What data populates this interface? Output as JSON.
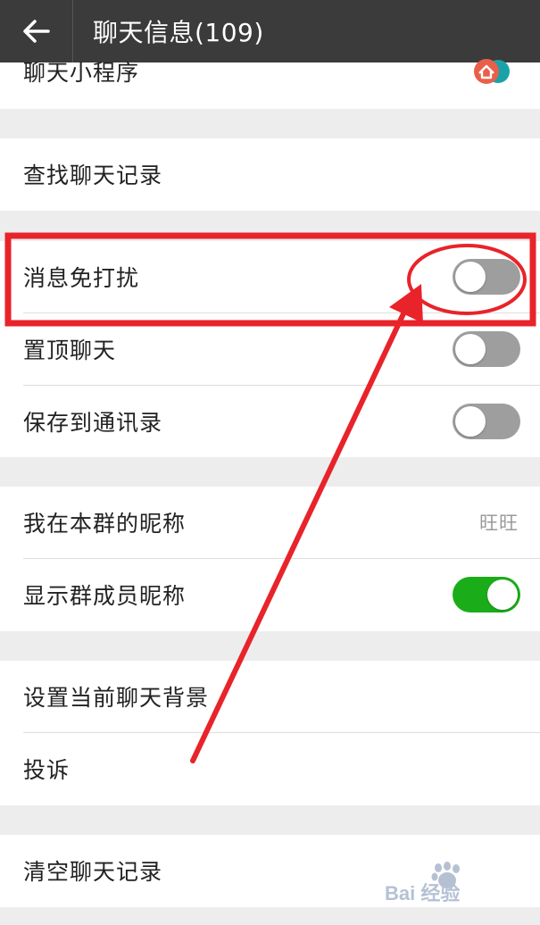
{
  "header": {
    "title": "聊天信息(109)"
  },
  "sections": {
    "miniprogram": {
      "label": "聊天小程序",
      "icon": "mini-program-icon"
    },
    "search": {
      "label": "查找聊天记录"
    },
    "dnd": {
      "label": "消息免打扰",
      "on": false
    },
    "pin": {
      "label": "置顶聊天",
      "on": false
    },
    "save_contacts": {
      "label": "保存到通讯录",
      "on": false
    },
    "nickname": {
      "label": "我在本群的昵称",
      "value": "旺旺"
    },
    "show_nicknames": {
      "label": "显示群成员昵称",
      "on": true
    },
    "background": {
      "label": "设置当前聊天背景"
    },
    "report": {
      "label": "投诉"
    },
    "clear": {
      "label": "清空聊天记录"
    }
  },
  "colors": {
    "topbar": "#3b3b3b",
    "switch_on": "#1aad19",
    "switch_off": "#9e9e9e",
    "annotation": "#e8232a"
  },
  "watermark": "Baidu 经验"
}
